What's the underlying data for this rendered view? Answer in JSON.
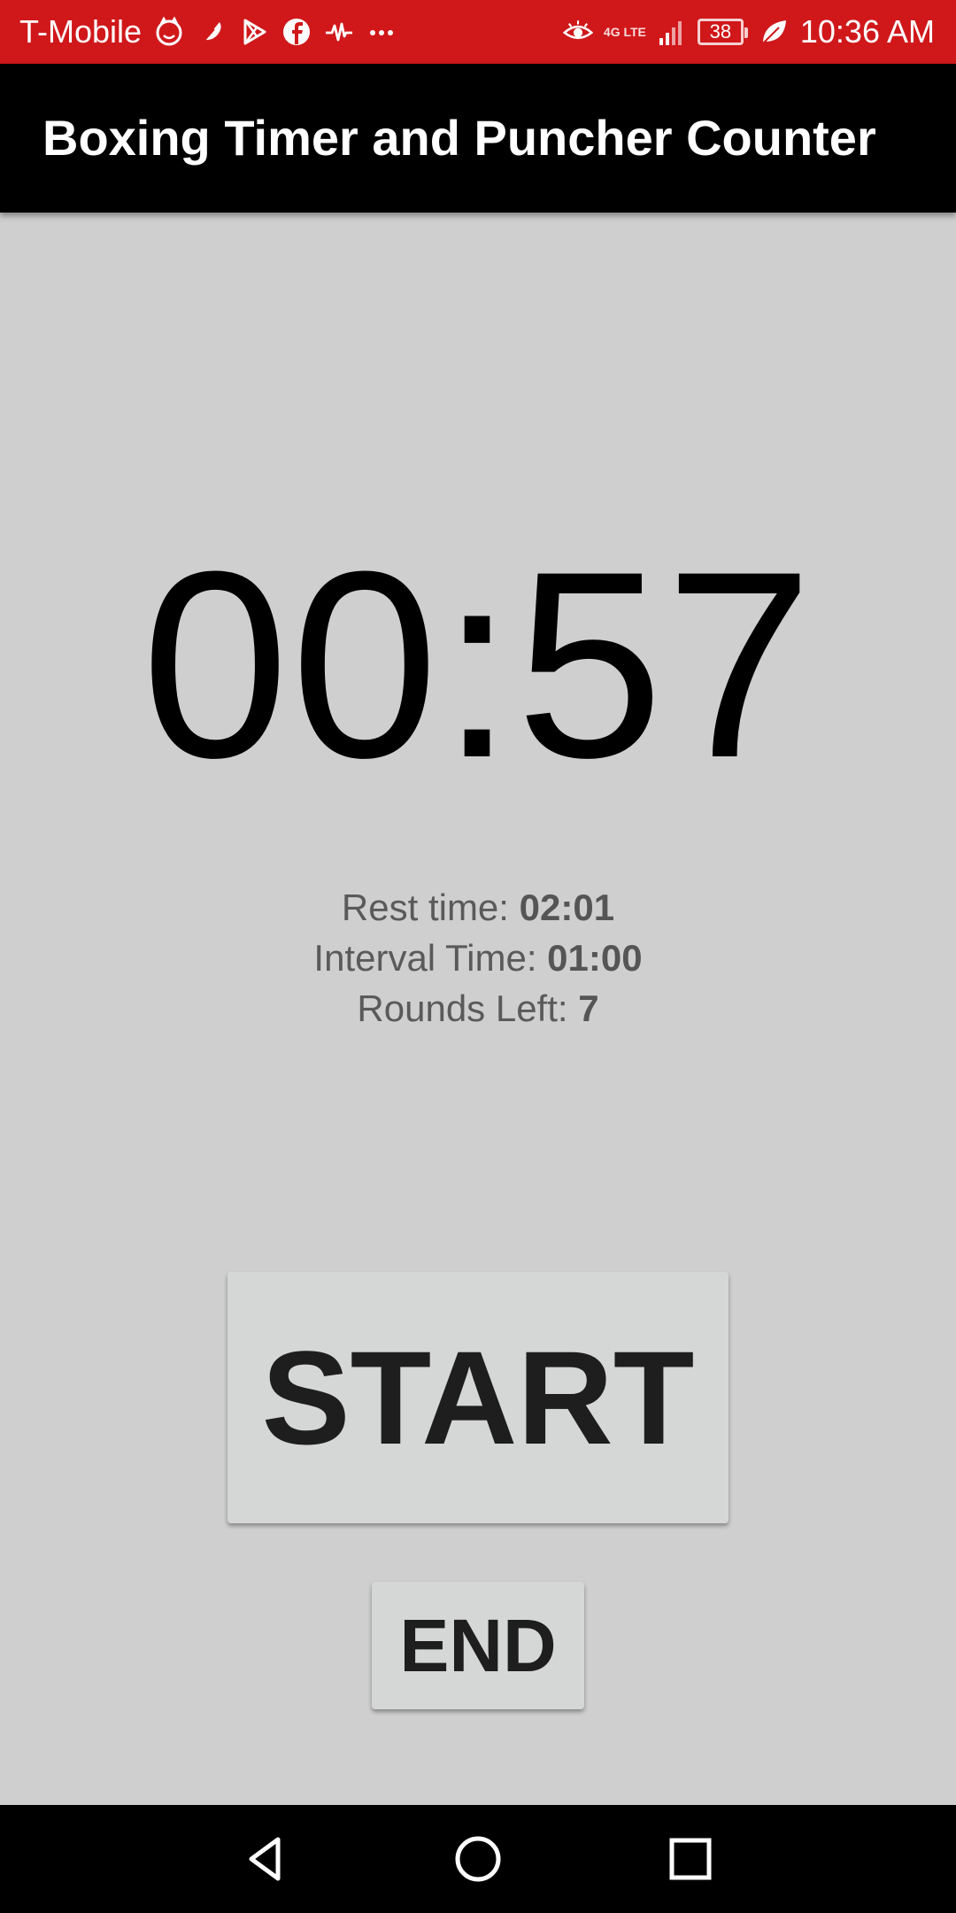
{
  "status_bar": {
    "carrier": "T-Mobile",
    "network": "4G LTE",
    "battery": "38",
    "time": "10:36 AM",
    "left_icons": [
      "cat-face-icon",
      "feather-icon",
      "play-store-icon",
      "facebook-icon",
      "pulse-icon",
      "more-dots-icon"
    ],
    "right_icons": [
      "eye-icon",
      "network-icon",
      "signal-icon",
      "battery-icon",
      "leaf-icon"
    ],
    "background": "#d0181b"
  },
  "app_bar": {
    "title": "Boxing Timer and Puncher Counter",
    "background": "#000000"
  },
  "timer": {
    "display": "00:57"
  },
  "info": {
    "rest_label": "Rest time: ",
    "rest_value": "02:01",
    "interval_label": "Interval Time: ",
    "interval_value": "01:00",
    "rounds_label": "Rounds Left: ",
    "rounds_value": "7"
  },
  "buttons": {
    "start_label": "START",
    "end_label": "END"
  },
  "nav_bar": {
    "icons": [
      "back-icon",
      "home-icon",
      "recent-apps-icon"
    ]
  }
}
